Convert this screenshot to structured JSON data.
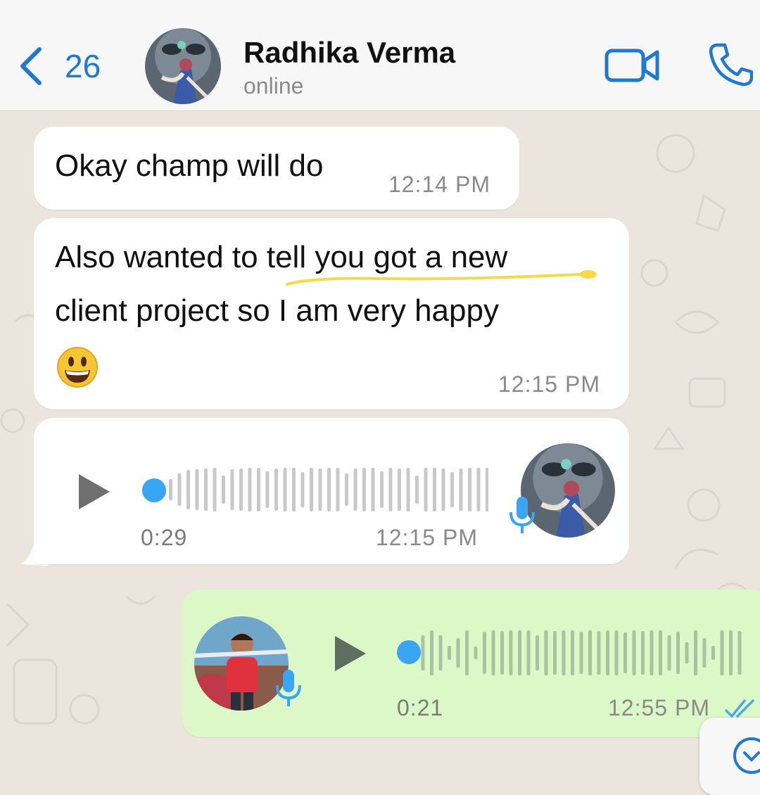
{
  "header": {
    "back_count": "26",
    "contact_name": "Radhika Verma",
    "status": "online"
  },
  "messages": [
    {
      "type": "text",
      "direction": "incoming",
      "text": "Okay champ will do",
      "time": "12:14 PM"
    },
    {
      "type": "text",
      "direction": "incoming",
      "line1": "Also wanted to tell you got a new",
      "line2": "client project so I am very happy",
      "emoji": "grinning-face",
      "time": "12:15 PM"
    },
    {
      "type": "voice",
      "direction": "incoming",
      "duration": "0:29",
      "time": "12:15 PM"
    },
    {
      "type": "voice",
      "direction": "outgoing",
      "duration": "0:21",
      "time": "12:55 PM",
      "status": "read"
    }
  ],
  "colors": {
    "accent": "#1f78d1",
    "incoming_bubble": "#ffffff",
    "outgoing_bubble": "#dcf8c6",
    "seek_dot": "#3aa5f5",
    "highlight": "#f6d94a",
    "background": "#ece5dd"
  }
}
